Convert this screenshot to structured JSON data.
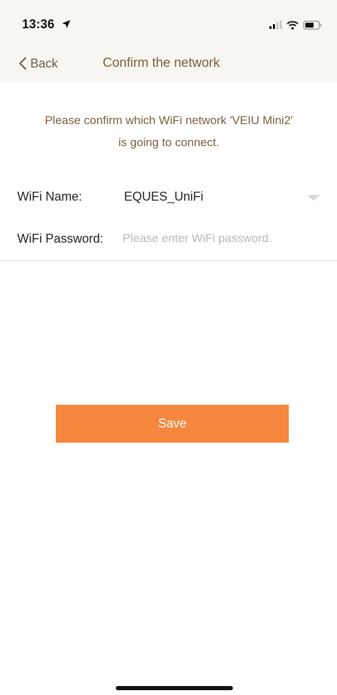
{
  "status_bar": {
    "time": "13:36",
    "icons": [
      "location-arrow-icon",
      "cellular-signal-icon",
      "wifi-icon",
      "battery-icon"
    ]
  },
  "nav": {
    "back_label": "Back",
    "title": "Confirm the network"
  },
  "intro": {
    "line1": "Please confirm which WiFi network 'VEIU Mini2'",
    "line2": "is going to connect."
  },
  "form": {
    "wifi_name_label": "WiFi Name:",
    "wifi_name_value": "EQUES_UniFi",
    "wifi_password_label": "WiFi Password:",
    "wifi_password_value": "",
    "wifi_password_placeholder": "Please enter WiFi password."
  },
  "actions": {
    "save_label": "Save"
  },
  "colors": {
    "accent": "#f5873e",
    "nav_text": "#7a5e3b",
    "header_background": "#f8f6f1",
    "placeholder": "#b8b8b8"
  }
}
